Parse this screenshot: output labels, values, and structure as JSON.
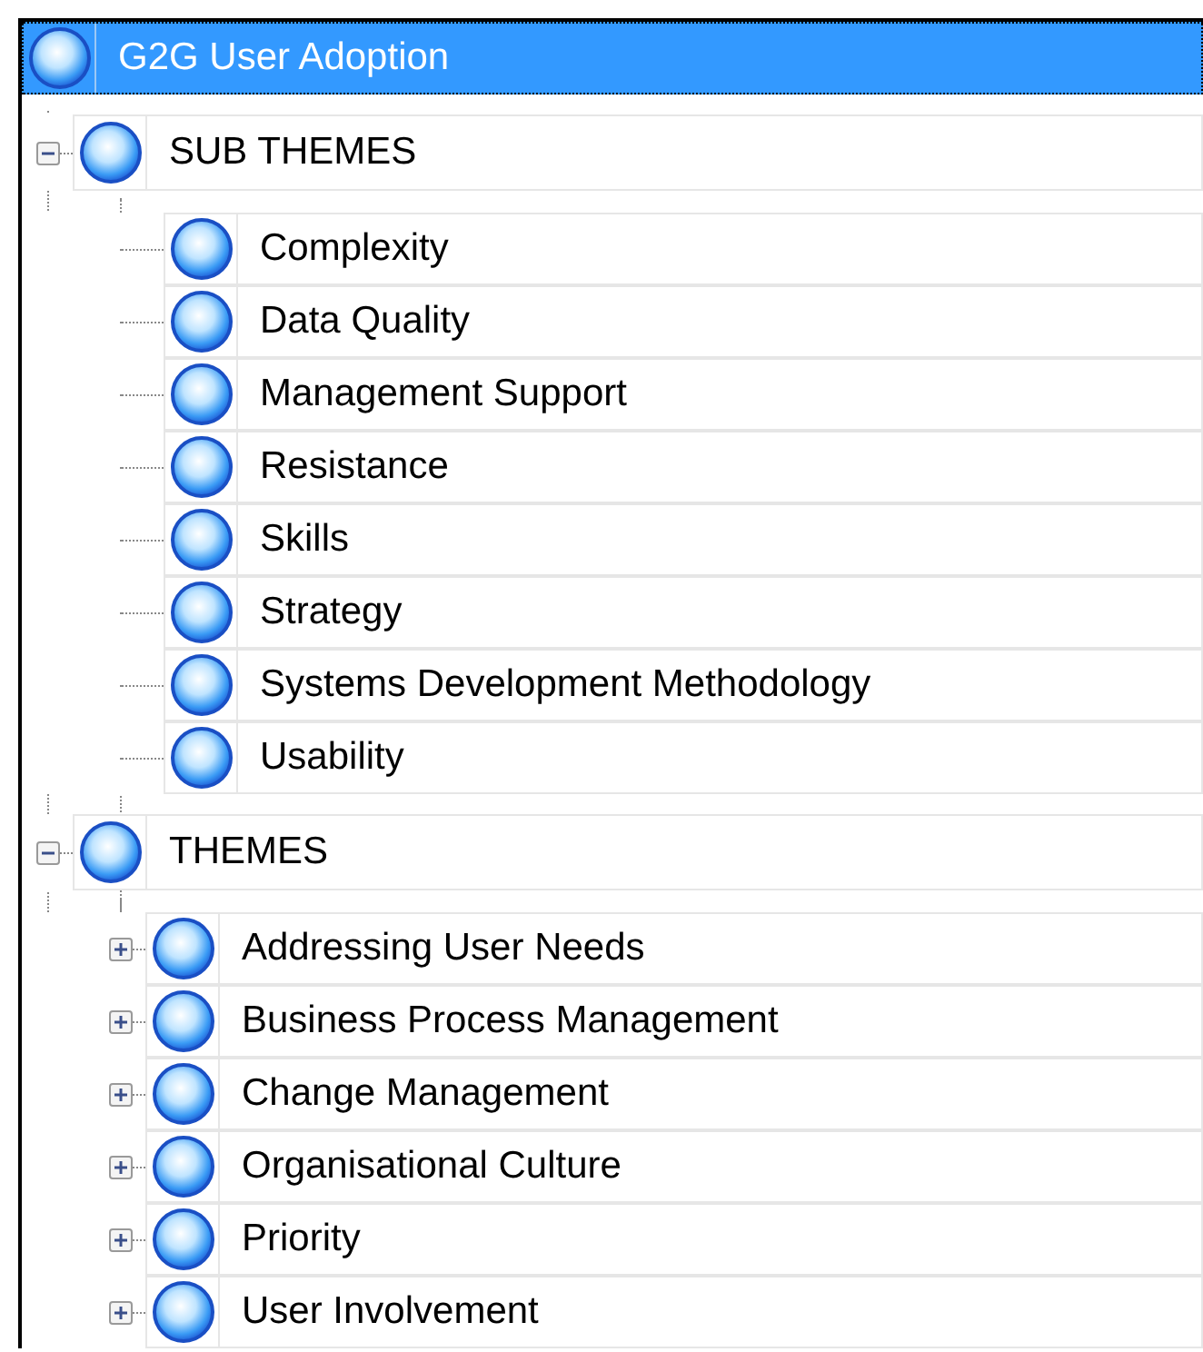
{
  "root": {
    "label": "G2G User Adoption",
    "selected": true
  },
  "groups": [
    {
      "label": "SUB THEMES",
      "expanded": true,
      "children": [
        {
          "label": "Complexity",
          "kind": "leaf"
        },
        {
          "label": "Data Quality",
          "kind": "leaf"
        },
        {
          "label": "Management Support",
          "kind": "leaf"
        },
        {
          "label": "Resistance",
          "kind": "leaf"
        },
        {
          "label": "Skills",
          "kind": "leaf"
        },
        {
          "label": "Strategy",
          "kind": "leaf"
        },
        {
          "label": "Systems Development Methodology",
          "kind": "leaf"
        },
        {
          "label": "Usability",
          "kind": "leaf"
        }
      ]
    },
    {
      "label": "THEMES",
      "expanded": true,
      "children": [
        {
          "label": "Addressing User Needs",
          "kind": "collapsed"
        },
        {
          "label": "Business Process Management",
          "kind": "collapsed"
        },
        {
          "label": "Change Management",
          "kind": "collapsed"
        },
        {
          "label": "Organisational Culture",
          "kind": "collapsed"
        },
        {
          "label": "Priority",
          "kind": "collapsed"
        },
        {
          "label": "User Involvement",
          "kind": "collapsed"
        }
      ]
    }
  ]
}
